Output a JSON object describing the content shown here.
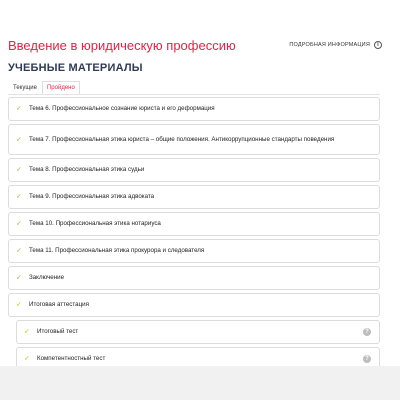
{
  "header": {
    "course_title": "Введение в юридическую профессию",
    "info_link": "ПОДРОБНАЯ ИНФОРМАЦИЯ",
    "info_icon_glyph": "i"
  },
  "section": {
    "title": "УЧЕБНЫЕ МАТЕРИАЛЫ"
  },
  "tabs": [
    {
      "label": "Текущие",
      "active": false
    },
    {
      "label": "Пройдено",
      "active": true
    }
  ],
  "items": [
    {
      "label": "Тема 6. Профессиональное сознание юриста и его деформация"
    },
    {
      "label": "Тема 7. Профессиональная этика юриста – общие положения. Антикоррупционные стандарты поведения"
    },
    {
      "label": "Тема 8. Профессиональная этика судьи"
    },
    {
      "label": "Тема 9. Профессиональная этика адвоката"
    },
    {
      "label": "Тема 10. Профессиональная этика нотариуса"
    },
    {
      "label": "Тема 11. Профессиональная этика прокурора и следователя"
    },
    {
      "label": "Заключение"
    },
    {
      "label": "Итоговая аттестация"
    }
  ],
  "sub_items": [
    {
      "label": "Итоговый тест"
    },
    {
      "label": "Компетентностный тест"
    }
  ],
  "icons": {
    "check": "✓",
    "help": "?"
  },
  "colors": {
    "brand_red": "#e32348",
    "check_green": "#8cc63f",
    "check_yellow": "#c8c800",
    "title_navy": "#2f3b55"
  }
}
